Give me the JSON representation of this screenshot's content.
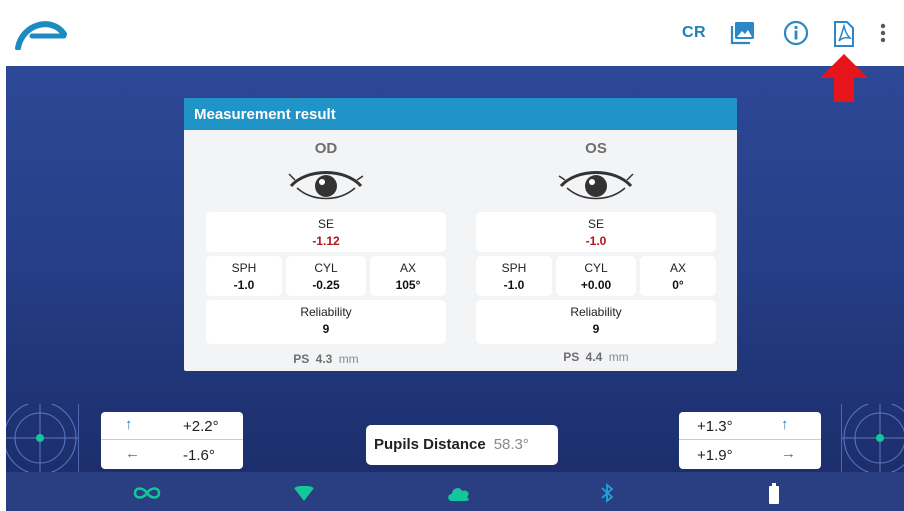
{
  "toolbar": {
    "cr_label": "CR",
    "icons": [
      "app-logo",
      "gallery-icon",
      "info-icon",
      "pdf-icon",
      "more-vert-icon"
    ]
  },
  "annotation": {
    "icon": "red-up-arrow",
    "color": "#e8141c"
  },
  "card": {
    "title": "Measurement result",
    "od": {
      "name": "OD",
      "se_label": "SE",
      "se_value": "-1.12",
      "sph_label": "SPH",
      "sph_value": "-1.0",
      "cyl_label": "CYL",
      "cyl_value": "-0.25",
      "ax_label": "AX",
      "ax_value": "105°",
      "reliability_label": "Reliability",
      "reliability_value": "9",
      "ps_label": "PS",
      "ps_value": "4.3",
      "ps_unit": "mm"
    },
    "os": {
      "name": "OS",
      "se_label": "SE",
      "se_value": "-1.0",
      "sph_label": "SPH",
      "sph_value": "-1.0",
      "cyl_label": "CYL",
      "cyl_value": "+0.00",
      "ax_label": "AX",
      "ax_value": "0°",
      "reliability_label": "Reliability",
      "reliability_value": "9",
      "ps_label": "PS",
      "ps_value": "4.4",
      "ps_unit": "mm"
    }
  },
  "controls": {
    "left": {
      "up_arrow": "↑",
      "up_value": "+2.2°",
      "left_arrow": "←",
      "left_value": "-1.6°"
    },
    "right": {
      "up_arrow": "↑",
      "up_value": "+1.3°",
      "right_arrow": "→",
      "right_value": "+1.9°"
    },
    "pupils_label": "Pupils Distance",
    "pupils_value": "58.3°"
  },
  "statusbar": {
    "icons": [
      "infinity-icon",
      "wifi-icon",
      "cloud-icon",
      "bluetooth-icon",
      "battery-icon"
    ]
  },
  "colors": {
    "accent": "#2094c6",
    "se_value": "#b0151b",
    "status_icon": "#14c79a",
    "background_blue": "#263f88"
  }
}
